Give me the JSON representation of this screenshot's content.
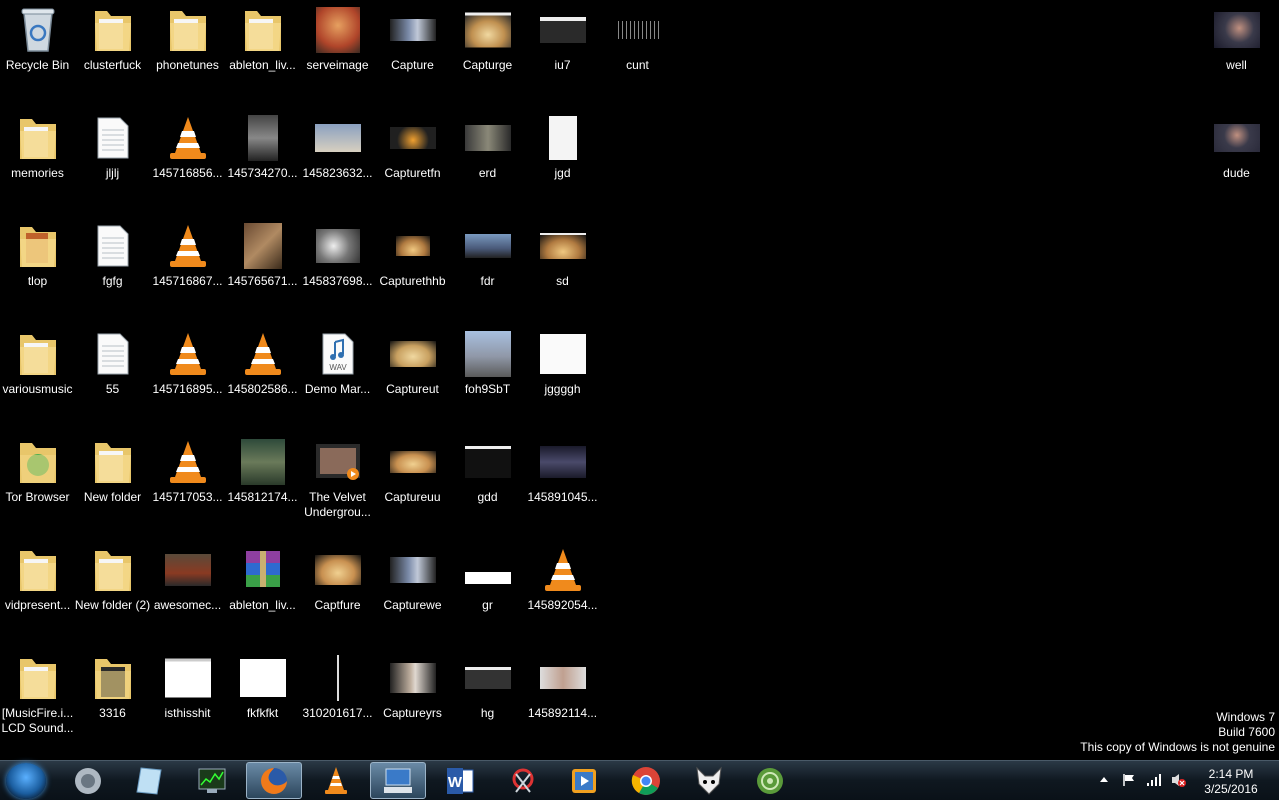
{
  "desktop": {
    "icons": [
      {
        "label": "Recycle Bin",
        "icon": "recycle-bin-icon"
      },
      {
        "label": "clusterfuck",
        "icon": "folder-icon"
      },
      {
        "label": "phonetunes",
        "icon": "folder-icon"
      },
      {
        "label": "ableton_liv...",
        "icon": "folder-icon"
      },
      {
        "label": "serveimage",
        "icon": "image-thumbnail-icon"
      },
      {
        "label": "Capture",
        "icon": "image-thumbnail-icon"
      },
      {
        "label": "Capturge",
        "icon": "image-thumbnail-icon"
      },
      {
        "label": "iu7",
        "icon": "image-thumbnail-icon"
      },
      {
        "label": "cunt",
        "icon": "image-thumbnail-icon"
      },
      {
        "label": "memories",
        "icon": "folder-icon"
      },
      {
        "label": "jljlj",
        "icon": "text-file-icon"
      },
      {
        "label": "145716856...",
        "icon": "vlc-icon"
      },
      {
        "label": "145734270...",
        "icon": "image-thumbnail-icon"
      },
      {
        "label": "145823632...",
        "icon": "image-thumbnail-icon"
      },
      {
        "label": "Capturetfn",
        "icon": "image-thumbnail-icon"
      },
      {
        "label": "erd",
        "icon": "image-thumbnail-icon"
      },
      {
        "label": "jgd",
        "icon": "image-thumbnail-icon"
      },
      {
        "label": "tlop",
        "icon": "folder-icon"
      },
      {
        "label": "fgfg",
        "icon": "text-file-icon"
      },
      {
        "label": "145716867...",
        "icon": "vlc-icon"
      },
      {
        "label": "145765671...",
        "icon": "image-thumbnail-icon"
      },
      {
        "label": "145837698...",
        "icon": "image-thumbnail-icon"
      },
      {
        "label": "Capturethhb",
        "icon": "image-thumbnail-icon"
      },
      {
        "label": "fdr",
        "icon": "image-thumbnail-icon"
      },
      {
        "label": "sd",
        "icon": "image-thumbnail-icon"
      },
      {
        "label": "variousmusic",
        "icon": "folder-icon"
      },
      {
        "label": "55",
        "icon": "text-file-icon"
      },
      {
        "label": "145716895...",
        "icon": "vlc-icon"
      },
      {
        "label": "145802586...",
        "icon": "vlc-icon"
      },
      {
        "label": "Demo Mar...",
        "icon": "wav-file-icon"
      },
      {
        "label": "Captureut",
        "icon": "image-thumbnail-icon"
      },
      {
        "label": "foh9SbT",
        "icon": "image-thumbnail-icon"
      },
      {
        "label": "jggggh",
        "icon": "image-thumbnail-icon"
      },
      {
        "label": "Tor Browser",
        "icon": "folder-icon"
      },
      {
        "label": "New folder",
        "icon": "folder-icon"
      },
      {
        "label": "145717053...",
        "icon": "vlc-icon"
      },
      {
        "label": "145812174...",
        "icon": "image-thumbnail-icon"
      },
      {
        "label": "The Velvet Undergrou...",
        "icon": "video-file-icon"
      },
      {
        "label": "Captureuu",
        "icon": "image-thumbnail-icon"
      },
      {
        "label": "gdd",
        "icon": "image-thumbnail-icon"
      },
      {
        "label": "145891045...",
        "icon": "image-thumbnail-icon"
      },
      {
        "label": "vidpresent...",
        "icon": "folder-icon"
      },
      {
        "label": "New folder (2)",
        "icon": "folder-icon"
      },
      {
        "label": "awesomec...",
        "icon": "image-thumbnail-icon"
      },
      {
        "label": "ableton_liv...",
        "icon": "winrar-icon"
      },
      {
        "label": "Captfure",
        "icon": "image-thumbnail-icon"
      },
      {
        "label": "Capturewe",
        "icon": "image-thumbnail-icon"
      },
      {
        "label": "gr",
        "icon": "image-thumbnail-icon"
      },
      {
        "label": "145892054...",
        "icon": "vlc-icon"
      },
      {
        "label": "[MusicFire.i... LCD Sound...",
        "icon": "folder-icon"
      },
      {
        "label": "3316",
        "icon": "folder-icon"
      },
      {
        "label": "isthisshit",
        "icon": "image-thumbnail-icon"
      },
      {
        "label": "fkfkfkt",
        "icon": "image-thumbnail-icon"
      },
      {
        "label": "310201617...",
        "icon": "image-thumbnail-icon"
      },
      {
        "label": "Captureyrs",
        "icon": "image-thumbnail-icon"
      },
      {
        "label": "hg",
        "icon": "image-thumbnail-icon"
      },
      {
        "label": "145892114...",
        "icon": "image-thumbnail-icon"
      },
      {
        "label": "well",
        "icon": "image-thumbnail-icon"
      },
      {
        "label": "dude",
        "icon": "image-thumbnail-icon"
      }
    ]
  },
  "watermark": {
    "line1": "Windows 7",
    "line2": "Build 7600",
    "line3": "This copy of Windows is not genuine"
  },
  "taskbar": {
    "pinned": [
      {
        "app": "speaker-icon"
      },
      {
        "app": "notepad-icon"
      },
      {
        "app": "task-manager-icon"
      },
      {
        "app": "firefox-icon"
      },
      {
        "app": "vlc-icon"
      },
      {
        "app": "remote-desktop-icon"
      },
      {
        "app": "word-icon"
      },
      {
        "app": "snipping-tool-icon"
      },
      {
        "app": "media-player-icon"
      },
      {
        "app": "chrome-icon"
      },
      {
        "app": "foobar-icon"
      },
      {
        "app": "tor-icon"
      }
    ],
    "clock": {
      "time": "2:14 PM",
      "date": "3/25/2016"
    }
  },
  "colors": {
    "folder": "#f2d27a",
    "vlc_orange": "#f08a1c",
    "taskbar": "#0f1820"
  }
}
